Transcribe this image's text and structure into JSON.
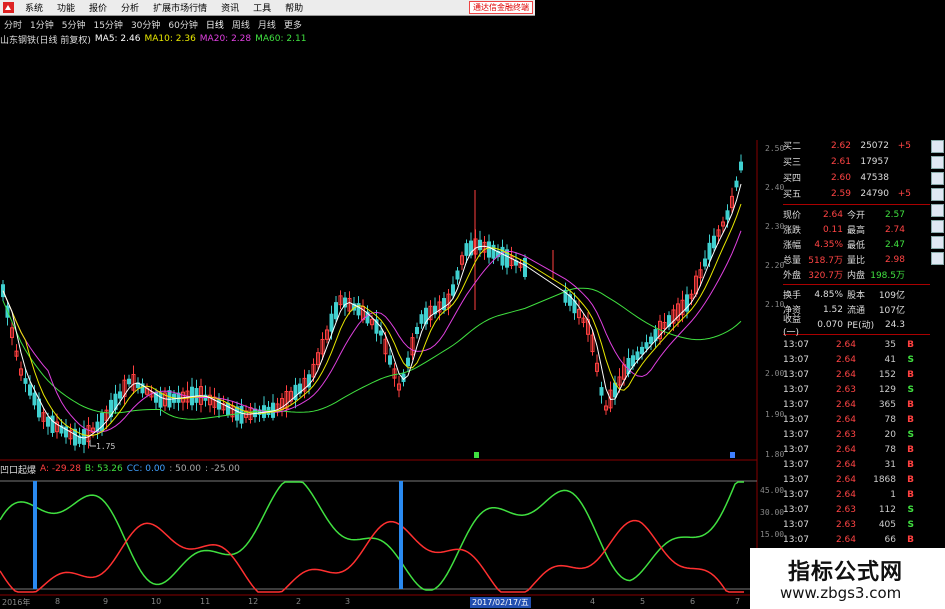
{
  "menu": {
    "items": [
      "系统",
      "功能",
      "报价",
      "分析",
      "扩展市场行情",
      "资讯",
      "工具",
      "帮助"
    ],
    "ad": "通达信金融终端"
  },
  "periods": {
    "items": [
      "分时",
      "1分钟",
      "5分钟",
      "15分钟",
      "30分钟",
      "60分钟",
      "日线",
      "周线",
      "月线",
      "更多"
    ],
    "active": 6
  },
  "ma_legend": {
    "title": "山东钢铁(日线 前复权)",
    "items": [
      {
        "label": "MA5: 2.46",
        "color": "#ffffff"
      },
      {
        "label": "MA10: 2.36",
        "color": "#e8e800"
      },
      {
        "label": "MA20: 2.28",
        "color": "#e040e0"
      },
      {
        "label": "MA60: 2.11",
        "color": "#40e040"
      }
    ]
  },
  "indicator_legend": {
    "title": "凹口起爆",
    "items": [
      {
        "label": "A: -29.28",
        "color": "#ff4040"
      },
      {
        "label": "B: 53.26",
        "color": "#40e040"
      },
      {
        "label": "CC: 0.00",
        "color": "#40a0ff"
      },
      {
        "label": ": 50.00",
        "color": "#aaaaaa"
      },
      {
        "label": ": -25.00",
        "color": "#aaaaaa"
      }
    ]
  },
  "price_axis": [
    "2.50",
    "2.40",
    "2.30",
    "2.20",
    "2.10",
    "2.00",
    "1.90",
    "1.80"
  ],
  "indicator_axis": [
    "45.00",
    "30.00",
    "15.00"
  ],
  "low_marker": "1.75",
  "date_axis": [
    "2016年",
    "8",
    "9",
    "10",
    "11",
    "12",
    "2",
    "3",
    "2017/02/17/五",
    "4",
    "5",
    "6",
    "7"
  ],
  "quote": {
    "orders": [
      {
        "label": "买二",
        "price": "2.62",
        "vol": "25072",
        "chg": "+5"
      },
      {
        "label": "买三",
        "price": "2.61",
        "vol": "17957",
        "chg": ""
      },
      {
        "label": "买四",
        "price": "2.60",
        "vol": "47538",
        "chg": ""
      },
      {
        "label": "买五",
        "price": "2.59",
        "vol": "24790",
        "chg": "+5"
      }
    ],
    "fields": [
      {
        "a": "现价",
        "b": "2.64",
        "c": "今开",
        "d": "2.57",
        "dc": "#40e040"
      },
      {
        "a": "涨跌",
        "b": "0.11",
        "c": "最高",
        "d": "2.74",
        "dc": "#f44"
      },
      {
        "a": "涨幅",
        "b": "4.35%",
        "c": "最低",
        "d": "2.47",
        "dc": "#40e040"
      },
      {
        "a": "总量",
        "b": "518.7万",
        "c": "量比",
        "d": "2.98",
        "dc": "#f44"
      },
      {
        "a": "外盘",
        "b": "320.7万",
        "c": "内盘",
        "d": "198.5万",
        "dc": "#40e040"
      }
    ],
    "fields2": [
      {
        "a": "换手",
        "b": "4.85%",
        "c": "股本",
        "d": "109亿",
        "dc": "#ddd"
      },
      {
        "a": "净资",
        "b": "1.52",
        "c": "流通",
        "d": "107亿",
        "dc": "#ddd"
      },
      {
        "a": "收益(一)",
        "b": "0.070",
        "c": "PE(动)",
        "d": "24.3",
        "dc": "#ddd"
      }
    ],
    "ticks": [
      {
        "t": "13:07",
        "p": "2.64",
        "v": "35",
        "s": "B"
      },
      {
        "t": "13:07",
        "p": "2.64",
        "v": "41",
        "s": "S"
      },
      {
        "t": "13:07",
        "p": "2.64",
        "v": "152",
        "s": "B"
      },
      {
        "t": "13:07",
        "p": "2.63",
        "v": "129",
        "s": "S"
      },
      {
        "t": "13:07",
        "p": "2.64",
        "v": "365",
        "s": "B"
      },
      {
        "t": "13:07",
        "p": "2.64",
        "v": "78",
        "s": "B"
      },
      {
        "t": "13:07",
        "p": "2.63",
        "v": "20",
        "s": "S"
      },
      {
        "t": "13:07",
        "p": "2.64",
        "v": "78",
        "s": "B"
      },
      {
        "t": "13:07",
        "p": "2.64",
        "v": "31",
        "s": "B"
      },
      {
        "t": "13:07",
        "p": "2.64",
        "v": "1868",
        "s": "B"
      },
      {
        "t": "13:07",
        "p": "2.64",
        "v": "1",
        "s": "B"
      },
      {
        "t": "13:07",
        "p": "2.63",
        "v": "112",
        "s": "S"
      },
      {
        "t": "13:07",
        "p": "2.63",
        "v": "405",
        "s": "S"
      },
      {
        "t": "13:07",
        "p": "2.64",
        "v": "66",
        "s": "B"
      },
      {
        "t": "13:07",
        "p": "2.64",
        "v": "142",
        "s": "B"
      },
      {
        "t": "13:07",
        "p": "2.64",
        "v": "281",
        "s": "B"
      }
    ]
  },
  "watermark": {
    "line1": "指标公式网",
    "line2": "www.zbgs3.com"
  },
  "colors": {
    "up": "#ff4040",
    "down": "#40d0d0",
    "buy": "#ff4040",
    "sell": "#40e040"
  }
}
